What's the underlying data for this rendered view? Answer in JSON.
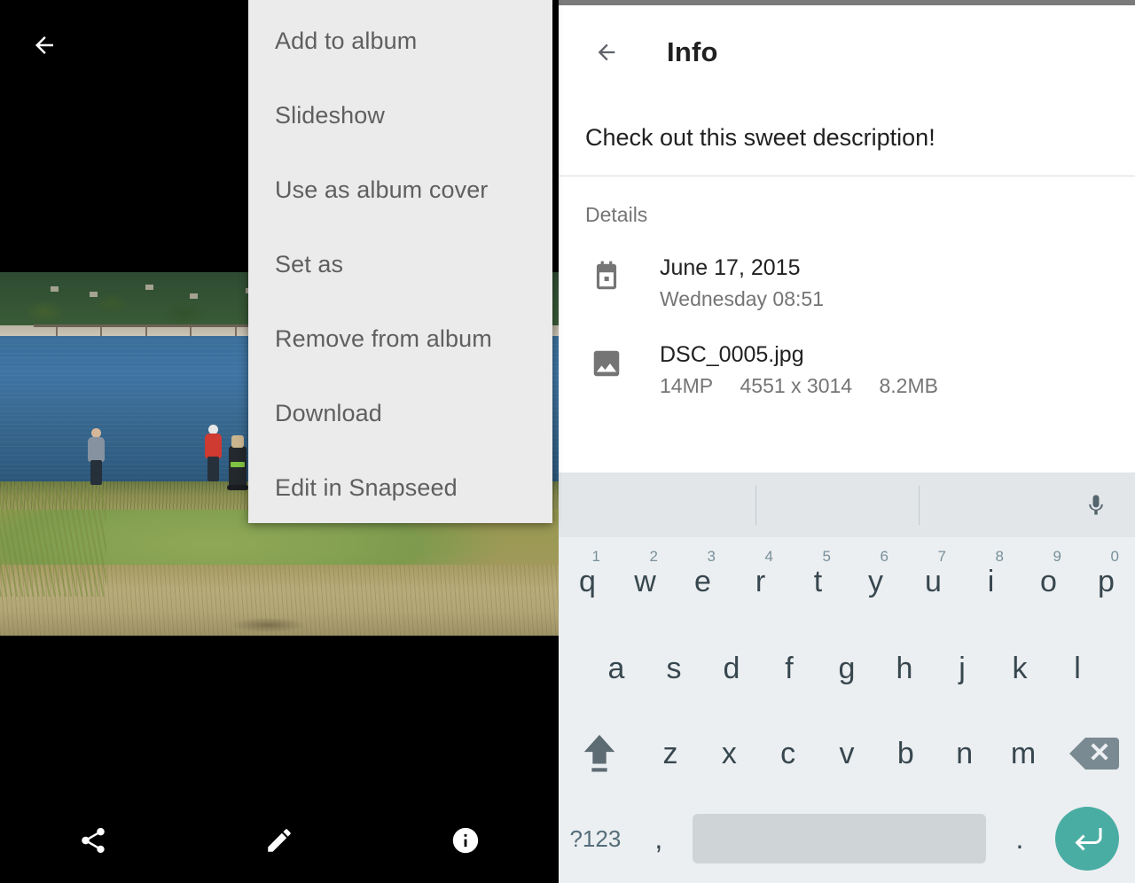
{
  "photo_viewer": {
    "back_icon": "arrow-left-icon",
    "toolbar": [
      {
        "name": "share-button",
        "icon": "share-icon"
      },
      {
        "name": "edit-button",
        "icon": "pencil-icon"
      },
      {
        "name": "info-button",
        "icon": "info-circle-icon"
      }
    ]
  },
  "overflow_menu": {
    "items": [
      {
        "label": "Add to album"
      },
      {
        "label": "Slideshow"
      },
      {
        "label": "Use as album cover"
      },
      {
        "label": "Set as"
      },
      {
        "label": "Remove from album"
      },
      {
        "label": "Download"
      },
      {
        "label": "Edit in Snapseed"
      }
    ],
    "background": "#ebebeb",
    "text_color": "#5f5f5f"
  },
  "info_panel": {
    "back_icon": "arrow-left-icon",
    "title": "Info",
    "description": "Check out this sweet description!",
    "details_label": "Details",
    "rows": [
      {
        "icon": "calendar-icon",
        "primary": "June 17, 2015",
        "secondary_parts": [
          "Wednesday 08:51"
        ]
      },
      {
        "icon": "image-icon",
        "primary": "DSC_0005.jpg",
        "secondary_parts": [
          "14MP",
          "4551 x 3014",
          "8.2MB"
        ]
      }
    ]
  },
  "keyboard": {
    "mic_icon": "microphone-icon",
    "row1": [
      {
        "letter": "q",
        "num": "1"
      },
      {
        "letter": "w",
        "num": "2"
      },
      {
        "letter": "e",
        "num": "3"
      },
      {
        "letter": "r",
        "num": "4"
      },
      {
        "letter": "t",
        "num": "5"
      },
      {
        "letter": "y",
        "num": "6"
      },
      {
        "letter": "u",
        "num": "7"
      },
      {
        "letter": "i",
        "num": "8"
      },
      {
        "letter": "o",
        "num": "9"
      },
      {
        "letter": "p",
        "num": "0"
      }
    ],
    "row2": [
      {
        "letter": "a"
      },
      {
        "letter": "s"
      },
      {
        "letter": "d"
      },
      {
        "letter": "f"
      },
      {
        "letter": "g"
      },
      {
        "letter": "h"
      },
      {
        "letter": "j"
      },
      {
        "letter": "k"
      },
      {
        "letter": "l"
      }
    ],
    "row3": [
      {
        "letter": "z"
      },
      {
        "letter": "x"
      },
      {
        "letter": "c"
      },
      {
        "letter": "v"
      },
      {
        "letter": "b"
      },
      {
        "letter": "n"
      },
      {
        "letter": "m"
      }
    ],
    "shift_icon": "shift-arrow-icon",
    "backspace_icon": "backspace-icon",
    "symbols_label": "?123",
    "comma_label": ",",
    "period_label": ".",
    "space_label": "",
    "enter_icon": "enter-return-icon",
    "enter_color": "#4aada4",
    "key_bg": "#eceff1",
    "suggestion_bg": "#e2e6e9",
    "space_bg": "#cfd4d6"
  }
}
